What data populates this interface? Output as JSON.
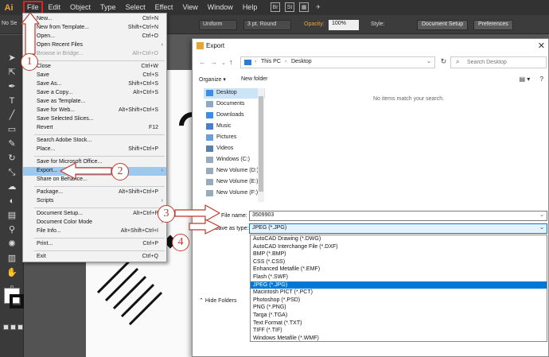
{
  "app": {
    "logo": "Ai"
  },
  "menubar": {
    "items": [
      "File",
      "Edit",
      "Object",
      "Type",
      "Select",
      "Effect",
      "View",
      "Window",
      "Help"
    ]
  },
  "controlbar": {
    "no_selection": "No Se",
    "stroke_style": "Uniform",
    "brush": "3 pt. Round",
    "opacity_label": "Opacity:",
    "opacity_value": "100%",
    "style_label": "Style:",
    "document_setup": "Document Setup",
    "preferences": "Preferences"
  },
  "file_menu": {
    "items": [
      {
        "label": "New...",
        "shortcut": "Ctrl+N"
      },
      {
        "label": "New from Template...",
        "shortcut": "Shift+Ctrl+N"
      },
      {
        "label": "Open...",
        "shortcut": "Ctrl+O"
      },
      {
        "label": "Open Recent Files",
        "shortcut": ""
      },
      {
        "label": "Browse in Bridge...",
        "shortcut": "Alt+Ctrl+O"
      },
      {
        "label": "Close",
        "shortcut": "Ctrl+W"
      },
      {
        "label": "Save",
        "shortcut": "Ctrl+S"
      },
      {
        "label": "Save As...",
        "shortcut": "Shift+Ctrl+S"
      },
      {
        "label": "Save a Copy...",
        "shortcut": "Alt+Ctrl+S"
      },
      {
        "label": "Save as Template...",
        "shortcut": ""
      },
      {
        "label": "Save for Web...",
        "shortcut": "Alt+Shift+Ctrl+S"
      },
      {
        "label": "Save Selected Slices...",
        "shortcut": ""
      },
      {
        "label": "Revert",
        "shortcut": "F12"
      },
      {
        "label": "Search Adobe Stock...",
        "shortcut": ""
      },
      {
        "label": "Place...",
        "shortcut": "Shift+Ctrl+P"
      },
      {
        "label": "Save for Microsoft Office...",
        "shortcut": ""
      },
      {
        "label": "Export...",
        "shortcut": ""
      },
      {
        "label": "Share on Behance...",
        "shortcut": ""
      },
      {
        "label": "Package...",
        "shortcut": "Alt+Shift+Ctrl+P"
      },
      {
        "label": "Scripts",
        "shortcut": ""
      },
      {
        "label": "Document Setup...",
        "shortcut": "Alt+Ctrl+P"
      },
      {
        "label": "Document Color Mode",
        "shortcut": ""
      },
      {
        "label": "File Info...",
        "shortcut": "Alt+Shift+Ctrl+I"
      },
      {
        "label": "Print...",
        "shortcut": "Ctrl+P"
      },
      {
        "label": "Exit",
        "shortcut": "Ctrl+Q"
      }
    ]
  },
  "export_dialog": {
    "title": "Export",
    "breadcrumb": [
      "This PC",
      "Desktop"
    ],
    "search_placeholder": "Search Desktop",
    "organize": "Organize",
    "new_folder": "New folder",
    "empty_message": "No items match your search.",
    "nav_items": [
      "Desktop",
      "Documents",
      "Downloads",
      "Music",
      "Pictures",
      "Videos",
      "Windows (C:)",
      "New Volume (D:)",
      "New Volume (E:)",
      "New Volume (F:)"
    ],
    "file_name_label": "File name:",
    "file_name_value": "3509903",
    "save_as_type_label": "Save as type:",
    "save_as_type_value": "JPEG (*.JPG)",
    "type_options": [
      "AutoCAD Drawing (*.DWG)",
      "AutoCAD Interchange File (*.DXF)",
      "BMP (*.BMP)",
      "CSS (*.CSS)",
      "Enhanced Metafile (*.EMF)",
      "Flash (*.SWF)",
      "JPEG (*.JPG)",
      "Macintosh PICT (*.PCT)",
      "Photoshop (*.PSD)",
      "PNG (*.PNG)",
      "Targa (*.TGA)",
      "Text Format (*.TXT)",
      "TIFF (*.TIF)",
      "Windows Metafile (*.WMF)"
    ],
    "selected_type_index": 6,
    "hide_folders": "Hide Folders"
  },
  "annotations": [
    "1",
    "2",
    "3",
    "4"
  ],
  "colors": {
    "annotation": "#c0392b",
    "selection": "#0078d7",
    "menu_highlight": "#9fc8ed"
  }
}
